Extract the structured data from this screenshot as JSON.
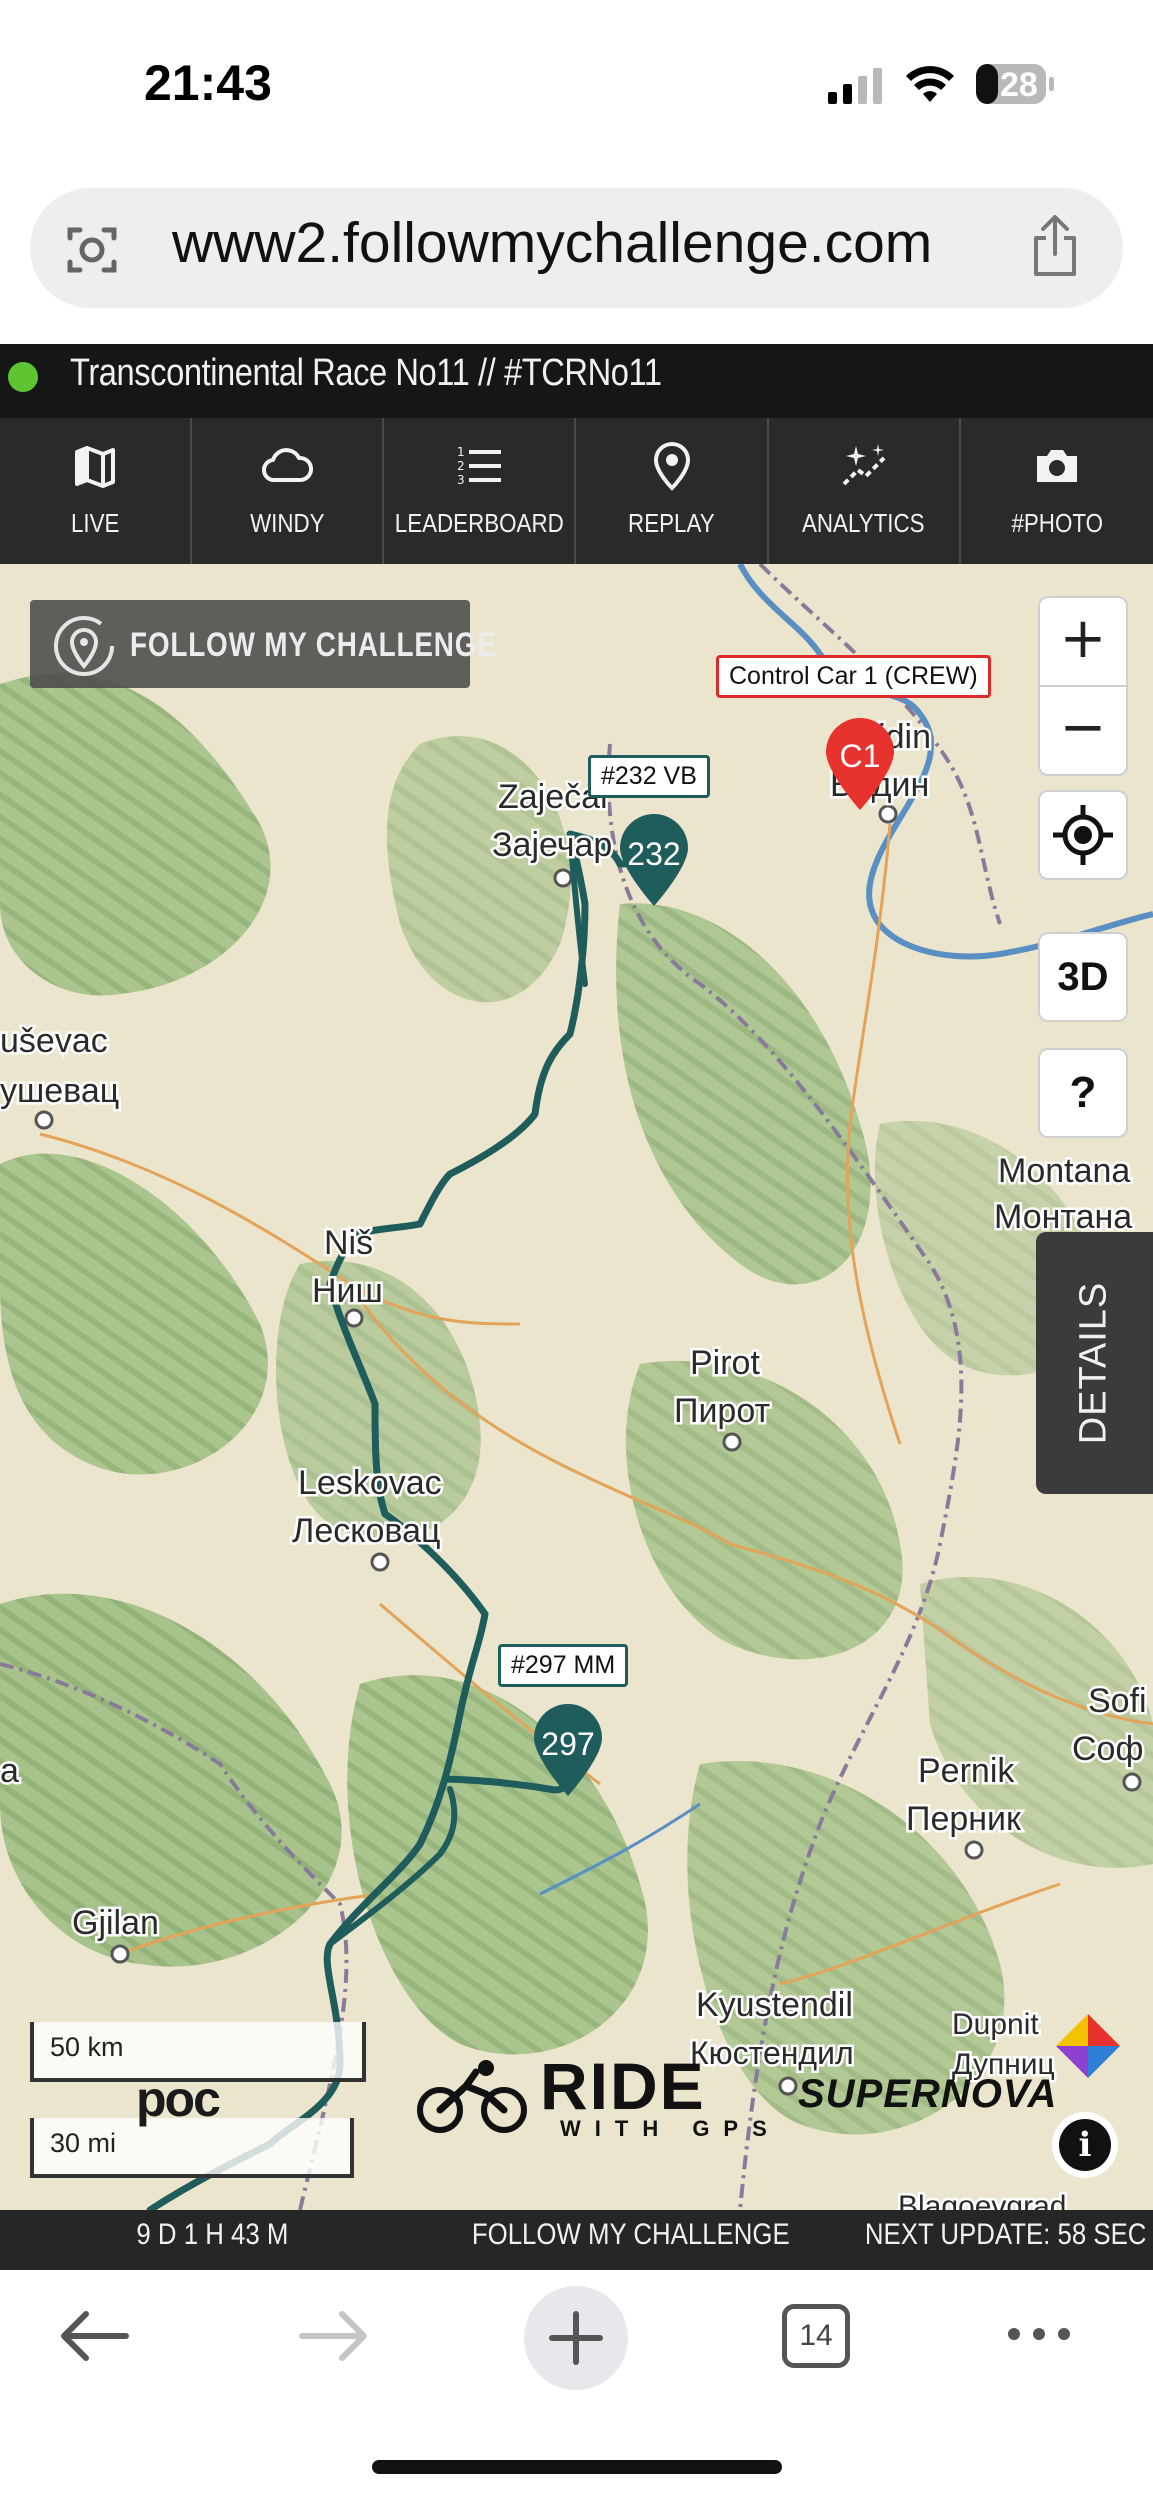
{
  "status_bar": {
    "time": "21:43",
    "battery": "28"
  },
  "browser": {
    "url": "www2.followmychallenge.com",
    "open_tabs": "14"
  },
  "app": {
    "title": "Transcontinental Race No11 // #TCRNo11",
    "live_indicator_color": "#5fc431",
    "nav": [
      {
        "label": "LIVE",
        "icon": "map-icon"
      },
      {
        "label": "WINDY",
        "icon": "cloud-icon"
      },
      {
        "label": "LEADERBOARD",
        "icon": "list-icon"
      },
      {
        "label": "REPLAY",
        "icon": "replay-pin-icon"
      },
      {
        "label": "ANALYTICS",
        "icon": "sparkle-chart-icon"
      },
      {
        "label": "#PHOTO",
        "icon": "camera-icon"
      }
    ]
  },
  "map": {
    "logo": "FOLLOW MY CHALLENGE",
    "controls": {
      "zoom_in": "+",
      "zoom_out": "−",
      "three_d": "3D",
      "help": "?"
    },
    "details_tab": "DETAILS",
    "places": [
      {
        "latin": "Zaječar",
        "cyrillic": "Зајечар"
      },
      {
        "latin": "Vidin",
        "cyrillic": "Видин"
      },
      {
        "latin": "uševac",
        "cyrillic": "ушевац"
      },
      {
        "latin": "Montana",
        "cyrillic": "Монтана"
      },
      {
        "latin": "Niš",
        "cyrillic": "Ниш"
      },
      {
        "latin": "Pirot",
        "cyrillic": "Пирот"
      },
      {
        "latin": "Leskovac",
        "cyrillic": "Лесковац"
      },
      {
        "latin": "Sofi",
        "cyrillic": "Соф"
      },
      {
        "latin": "Pernik",
        "cyrillic": "Перник"
      },
      {
        "latin": "Gjilan",
        "cyrillic": ""
      },
      {
        "latin": "Kyustendil",
        "cyrillic": "Кюстендил"
      },
      {
        "latin": "Dupnit",
        "cyrillic": "Дупниц"
      },
      {
        "latin": "a",
        "cyrillic": ""
      },
      {
        "latin": "Blagoevgrad",
        "cyrillic": ""
      }
    ],
    "riders": [
      {
        "number": "232",
        "callout": "#232 VB"
      },
      {
        "number": "297",
        "callout": "#297 MM"
      }
    ],
    "support_vehicle": {
      "marker": "C1",
      "callout": "Control Car 1 (CREW)",
      "color": "#e02a2a"
    },
    "route_color": "#1f5c5c",
    "scale": {
      "km": "50 km",
      "mi": "30 mi"
    },
    "sponsors": {
      "poc": "poc",
      "ride": "RIDE",
      "ride_sub": "WITH GPS",
      "supernova": "SUPERNOVA"
    },
    "info_button": "i"
  },
  "footer": {
    "elapsed": "9 D 1 H 43 M",
    "center": "FOLLOW MY CHALLENGE",
    "next_update": "NEXT UPDATE: 58 SEC"
  }
}
